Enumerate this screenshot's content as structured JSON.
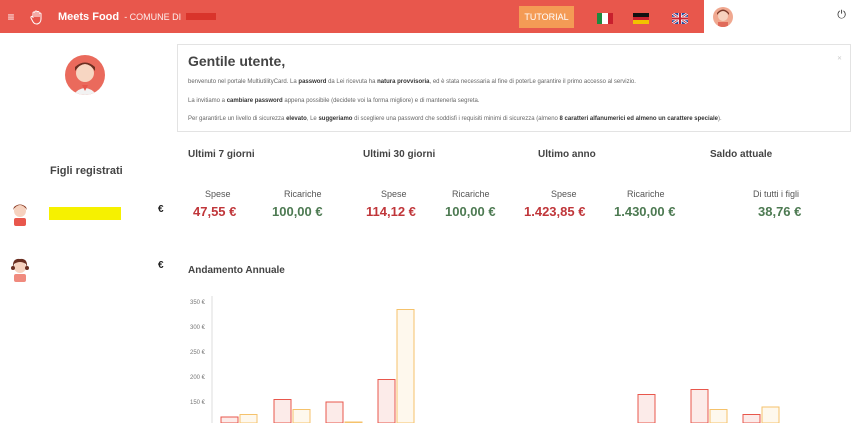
{
  "topbar": {
    "menu_icon": "hamburger-icon",
    "logo_icon": "hand-logo-icon",
    "brand": "Meets Food",
    "comune": "- COMUNE DI",
    "tutorial": "TUTORIAL",
    "languages": [
      "it",
      "de",
      "uk"
    ],
    "power_icon": "power-icon",
    "accent": "#e8574c"
  },
  "sidebar": {
    "figli_title": "Figli registrati",
    "children": [
      {
        "currency": "€"
      },
      {
        "currency": "€"
      }
    ]
  },
  "welcome": {
    "title": "Gentile utente,",
    "line1_a": "benvenuto nel portale MultiutilityCard. La ",
    "line1_b": "password",
    "line1_c": " da Lei ricevuta ha ",
    "line1_d": "natura provvisoria",
    "line1_e": ", ed è stata necessaria al fine di poterLe garantire il primo accesso al servizio.",
    "line2_a": "La invitiamo a ",
    "line2_b": "cambiare password",
    "line2_c": " appena possibile (decidete voi la forma migliore) e di mantenerla segreta.",
    "line3_a": "Per garantirLe un livello di sicurezza ",
    "line3_b": "elevato",
    "line3_c": ", Le ",
    "line3_d": "suggeriamo",
    "line3_e": " di scegliere una password che soddisfi i requisiti minimi di sicurezza (almeno ",
    "line3_f": "8 caratteri alfanumerici ed almeno un carattere speciale",
    "line3_g": ")."
  },
  "stats": {
    "col1": {
      "title": "Ultimi 7 giorni",
      "spese_label": "Spese",
      "ricariche_label": "Ricariche",
      "spese": "47,55 €",
      "ricariche": "100,00 €"
    },
    "col2": {
      "title": "Ultimi 30 giorni",
      "spese_label": "Spese",
      "ricariche_label": "Ricariche",
      "spese": "114,12 €",
      "ricariche": "100,00 €"
    },
    "col3": {
      "title": "Ultimo anno",
      "spese_label": "Spese",
      "ricariche_label": "Ricariche",
      "spese": "1.423,85 €",
      "ricariche": "1.430,00 €"
    },
    "col4": {
      "title": "Saldo attuale",
      "label": "Di tutti i figli",
      "value": "38,76 €"
    }
  },
  "chart_title": "Andamento Annuale",
  "chart_data": {
    "type": "bar",
    "y_ticks": [
      "350 €",
      "300 €",
      "250 €",
      "200 €",
      "150 €"
    ],
    "ylim": [
      125,
      355
    ],
    "series": [
      {
        "color": "#e8574c",
        "values": [
          120,
          155,
          150,
          195,
          null,
          null,
          null,
          165,
          175,
          125
        ]
      },
      {
        "color": "#f5c26b",
        "values": [
          125,
          135,
          110,
          335,
          null,
          null,
          null,
          null,
          135,
          140
        ]
      }
    ]
  }
}
